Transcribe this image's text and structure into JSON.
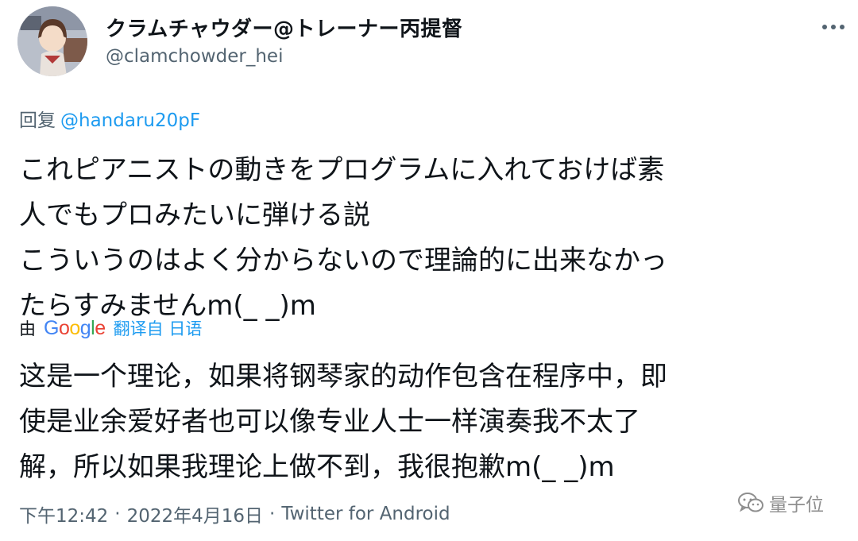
{
  "tweet": {
    "display_name": "クラムチャウダー@トレーナー丙提督",
    "handle": "@clamchowder_hei",
    "reply_prefix": "回复",
    "reply_to": "@handaru20pF",
    "text": "これピアニストの動きをプログラムに入れておけば素\n人でもプロみたいに弾ける説\nこういうのはよく分からないので理論的に出来なかっ\nたらすみませんm(_ _)m",
    "translation_prefix": "由",
    "translation_provider": [
      "G",
      "o",
      "o",
      "g",
      "l",
      "e"
    ],
    "translation_link": "翻译自 日语",
    "translation": "这是一个理论，如果将钢琴家的动作包含在程序中，即\n使是业余爱好者也可以像专业人士一样演奏我不太了\n解，所以如果我理论上做不到，我很抱歉m(_ _)m",
    "time": "下午12:42",
    "separator": "·",
    "date": "2022年4月16日",
    "source": "Twitter for Android"
  },
  "watermark": {
    "text": "量子位",
    "icon": "wechat-icon"
  },
  "icons": {
    "more": "more-options-icon",
    "avatar": "avatar-image"
  },
  "colors": {
    "link": "#1d9bf0",
    "secondary_text": "#536471",
    "google_letters": [
      "#4285F4",
      "#EA4335",
      "#FBBC05",
      "#4285F4",
      "#34A853",
      "#EA4335"
    ]
  }
}
